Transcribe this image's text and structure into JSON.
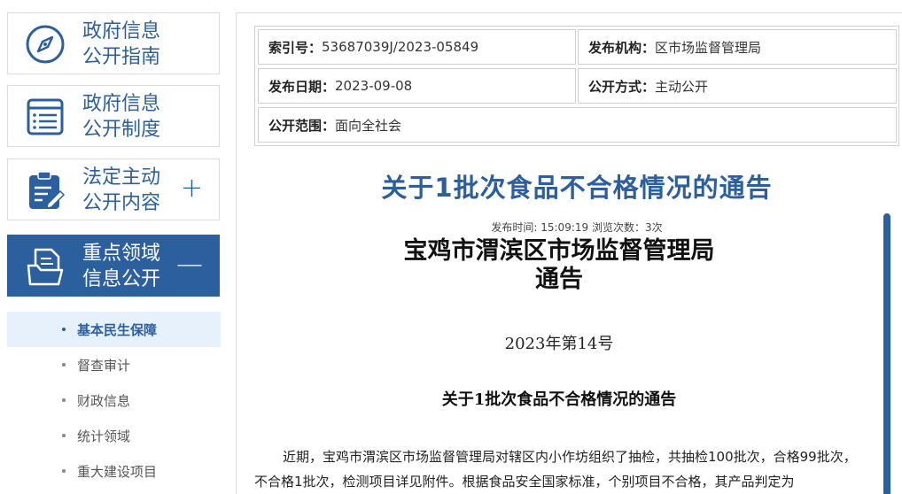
{
  "sidebar": {
    "buttons": [
      {
        "label_line1": "政府信息",
        "label_line2": "公开指南",
        "icon": "compass-icon",
        "sign": ""
      },
      {
        "label_line1": "政府信息",
        "label_line2": "公开制度",
        "icon": "document-list-icon",
        "sign": ""
      },
      {
        "label_line1": "法定主动",
        "label_line2": "公开内容",
        "icon": "clipboard-edit-icon",
        "sign": "+"
      },
      {
        "label_line1": "重点领域",
        "label_line2": "信息公开",
        "icon": "folder-document-icon",
        "sign": "—"
      }
    ],
    "sub_items": [
      {
        "label": "基本民生保障",
        "active": true
      },
      {
        "label": "督查审计",
        "active": false
      },
      {
        "label": "财政信息",
        "active": false
      },
      {
        "label": "统计领域",
        "active": false
      },
      {
        "label": "重大建设项目",
        "active": false
      }
    ]
  },
  "meta": {
    "index_label": "索引号：",
    "index_value": "53687039J/2023-05849",
    "org_label": "发布机构：",
    "org_value": "区市场监督管理局",
    "date_label": "发布日期：",
    "date_value": "2023-09-08",
    "mode_label": "公开方式：",
    "mode_value": "主动公开",
    "scope_label": "公开范围：",
    "scope_value": "面向全社会"
  },
  "article": {
    "title": "关于1批次食品不合格情况的通告",
    "pub_info": "发布时间: 15:09:19 浏览次数：3次",
    "org_line1": "宝鸡市渭滨区市场监督管理局",
    "org_line2": "通告",
    "doc_number": "2023年第14号",
    "subtitle": "关于1批次食品不合格情况的通告",
    "body": "近期，宝鸡市渭滨区市场监督管理局对辖区内小作坊组织了抽检，共抽检100批次，合格99批次，不合格1批次，检测项目详见附件。根据食品安全国家标准，个别项目不合格，其产品判定为"
  },
  "colors": {
    "brand_blue": "#2c5f9e",
    "active_sub_bg": "#e6f1fb"
  }
}
